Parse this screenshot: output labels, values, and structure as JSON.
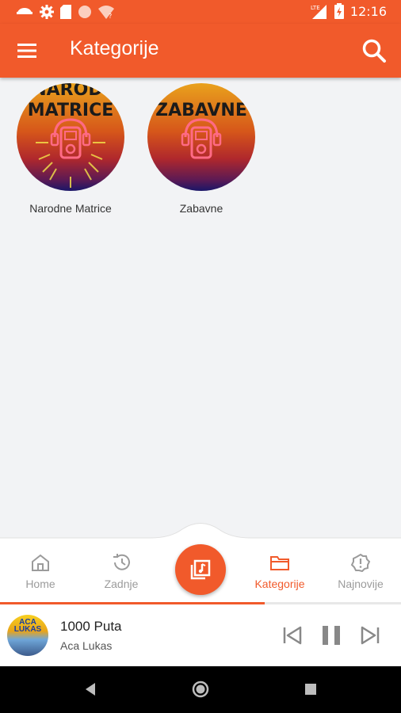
{
  "status_bar": {
    "time": "12:16",
    "network": "LTE",
    "icons": [
      "android-icon",
      "settings-icon",
      "sd-card-icon",
      "circle-icon",
      "wifi-question-icon",
      "signal-icon",
      "battery-icon"
    ]
  },
  "app_bar": {
    "title": "Kategorije",
    "menu_icon": "hamburger-menu-icon",
    "search_icon": "search-icon"
  },
  "categories": [
    {
      "label": "Narodne Matrice",
      "banner": "NARODI\nMATRICE"
    },
    {
      "label": "Zabavne",
      "banner": "ZABAVNE"
    }
  ],
  "bottom_nav": {
    "items": [
      {
        "label": "Home",
        "icon": "home-icon"
      },
      {
        "label": "Zadnje",
        "icon": "history-icon"
      },
      {
        "label": "Kategorije",
        "icon": "folder-icon",
        "active": true
      },
      {
        "label": "Najnovije",
        "icon": "new-alert-icon"
      }
    ],
    "center_icon": "music-library-icon"
  },
  "player": {
    "song": "1000 Puta",
    "artist": "Aca Lukas",
    "art_text": "ACA LUKAS",
    "progress": 0.66
  },
  "colors": {
    "accent": "#f15a2b",
    "inactive": "#9b9b9b",
    "background": "#f2f3f5"
  }
}
